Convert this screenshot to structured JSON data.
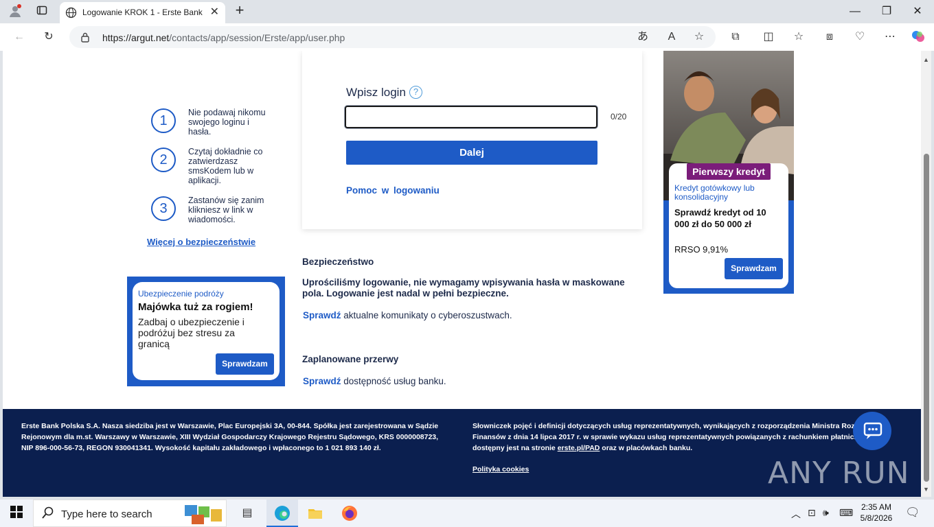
{
  "browser": {
    "tab_title": "Logowanie KROK 1 - Erste Bank Po",
    "url_host": "https://argut.net",
    "url_path": "/contacts/app/session/Erste/app/user.php"
  },
  "steps": [
    {
      "num": "1",
      "text": "Nie podawaj nikomu swojego loginu i hasła."
    },
    {
      "num": "2",
      "text": "Czytaj dokładnie co zatwierdzasz smsKodem lub w aplikacji."
    },
    {
      "num": "3",
      "text": "Zastanów się zanim klikniesz w link w wiadomości."
    }
  ],
  "more_security_link": "Więcej o bezpieczeństwie",
  "ad_travel": {
    "kicker": "Ubezpieczenie podróży",
    "headline": "Majówka tuż za rogiem!",
    "body": "Zadbaj o ubezpieczenie i podróżuj bez stresu za granicą",
    "button": "Sprawdzam"
  },
  "login": {
    "label": "Wpisz login",
    "help_icon": "?",
    "input_value": "",
    "counter": "0/20",
    "next_button": "Dalej",
    "help_link": "Pomoc w logowaniu"
  },
  "info": {
    "security_heading": "Bezpieczeństwo",
    "security_text": "Uprościliśmy logowanie, nie wymagamy wpisywania hasła w maskowane pola. Logowanie jest nadal w pełni bezpieczne.",
    "cyber_link": "Sprawdź",
    "cyber_text": " aktualne komunikaty o cyberoszustwach.",
    "breaks_heading": "Zaplanowane przerwy",
    "breaks_link": "Sprawdź",
    "breaks_text": " dostępność usług banku."
  },
  "ad_loan": {
    "badge": "Pierwszy kredyt",
    "sub": "Kredyt gotówkowy lub konsolidacyjny",
    "main": "Sprawdź kredyt od 10 000 zł do 50 000 zł",
    "rrso": "RRSO 9,91%",
    "button": "Sprawdzam"
  },
  "footer": {
    "left": "Erste Bank Polska S.A. Nasza siedziba jest w Warszawie, Plac Europejski 3A, 00-844. Spółka jest zarejestrowana w Sądzie Rejonowym dla m.st. Warszawy w Warszawie, XIII Wydział Gospodarczy Krajowego Rejestru Sądowego, KRS 0000008723, NIP 896-000-56-73, REGON 930041341. Wysokość kapitału zakładowego i wpłaconego to 1 021 893 140 zł.",
    "right_before": "Słowniczek pojęć i definicji dotyczących usług reprezentatywnych, wynikających z rozporządzenia Ministra Rozwoju i Finansów z dnia 14 lipca 2017 r. w sprawie wykazu usług reprezentatywnych powiązanych z rachunkiem płatniczym, dostępny jest na stronie ",
    "right_link": "erste.pl/PAD",
    "right_after": " oraz w placówkach banku.",
    "cookies": "Polityka cookies",
    "watermark": "ANY RUN"
  },
  "taskbar": {
    "search_placeholder": "Type here to search",
    "time": "2:35 AM",
    "date": "5/8/2026"
  },
  "colors": {
    "brand_blue": "#1e5bc6",
    "footer_navy": "#0b1f4f",
    "badge_purple": "#7b1d7a"
  }
}
